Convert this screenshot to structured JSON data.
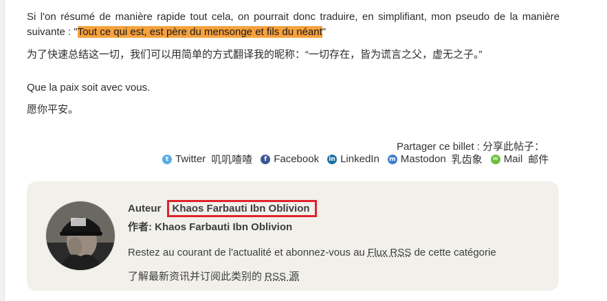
{
  "article": {
    "p1_before": "Si l'on résumé de manière rapide tout cela, on pourrait donc traduire, en simplifiant, mon pseudo de la manière suivante : \"",
    "p1_highlight": "Tout ce qui est, est père du mensonge et fils du néant",
    "p1_after": "\"",
    "p2": "为了快速总结这一切，我们可以用简单的方式翻译我的昵称：“一切存在，皆为谎言之父，虚无之子。”",
    "p3": "Que la paix soit avec vous.",
    "p4": "愿你平安。"
  },
  "share": {
    "title": "Partager ce billet :  分享此帖子：",
    "items": [
      {
        "icon": "twitter-icon",
        "label": "Twitter",
        "label_cn": "叽叽喳喳"
      },
      {
        "icon": "facebook-icon",
        "label": "Facebook"
      },
      {
        "icon": "linkedin-icon",
        "label": "LinkedIn"
      },
      {
        "icon": "mastodon-icon",
        "label": "Mastodon",
        "label_cn": "乳齿象"
      },
      {
        "icon": "mail-icon",
        "label": "Mail",
        "label_cn": "邮件"
      }
    ]
  },
  "author": {
    "label_fr": "Auteur",
    "name": "Khaos Farbauti Ibn Oblivion",
    "line_cn": "作者: Khaos Farbauti Ibn Oblivion",
    "rss_fr_before": "Restez au courant de l'actualité et abonnez-vous au ",
    "rss_fr_link": "Flux RSS",
    "rss_fr_after": " de cette catégorie",
    "rss_cn_before": "了解最新资讯并订阅此类别的 ",
    "rss_cn_link": "RSS 源"
  },
  "colors": {
    "highlight": "#f7a13d",
    "author_box_bg": "#f1f0eb",
    "annotation_border": "#e0202a"
  }
}
